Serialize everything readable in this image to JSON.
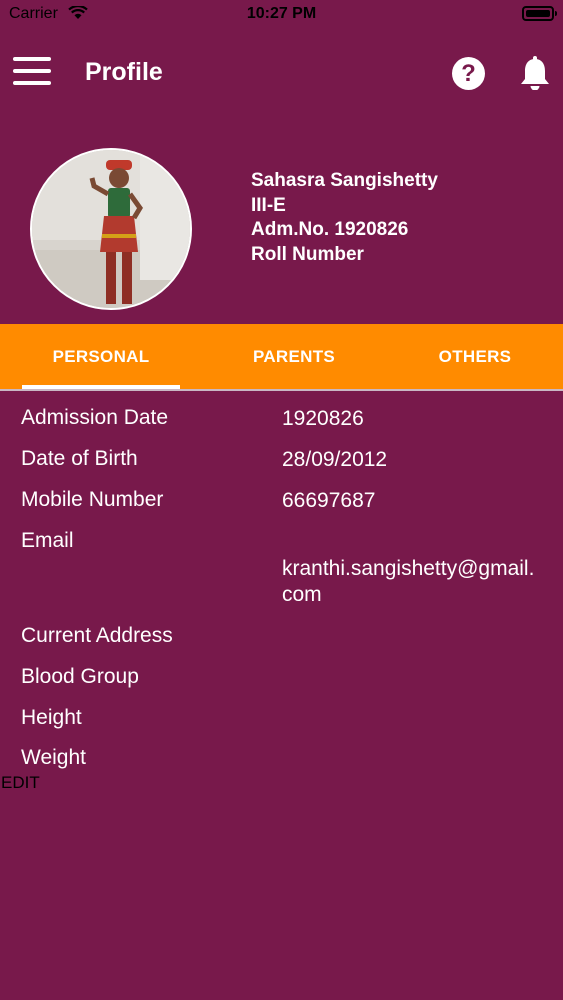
{
  "status_bar": {
    "carrier": "Carrier",
    "time": "10:27 PM"
  },
  "header": {
    "title": "Profile",
    "help_symbol": "?"
  },
  "profile": {
    "name": "Sahasra Sangishetty",
    "class": "III-E",
    "admission_no": "Adm.No. 1920826",
    "roll_number": "Roll Number"
  },
  "tabs": [
    {
      "label": "PERSONAL",
      "active": true
    },
    {
      "label": "PARENTS",
      "active": false
    },
    {
      "label": "OTHERS",
      "active": false
    }
  ],
  "fields": [
    {
      "label": "Admission Date",
      "value": "1920826"
    },
    {
      "label": "Date of Birth",
      "value": "28/09/2012"
    },
    {
      "label": "Mobile Number",
      "value": "66697687"
    },
    {
      "label": "Email",
      "value_line1": "kranthi.sangishetty@gmail.",
      "value_line2": "com"
    },
    {
      "label": "Current Address",
      "value": ""
    },
    {
      "label": "Blood Group",
      "value": ""
    },
    {
      "label": "Height",
      "value": ""
    },
    {
      "label": "Weight",
      "value": ""
    }
  ],
  "edit_label": "EDIT",
  "colors": {
    "background": "#78194b",
    "tab_bar": "#ff8b00",
    "text": "#ffffff"
  },
  "icons": {
    "menu": "hamburger-menu-icon",
    "help": "help-icon",
    "notifications": "bell-icon"
  }
}
